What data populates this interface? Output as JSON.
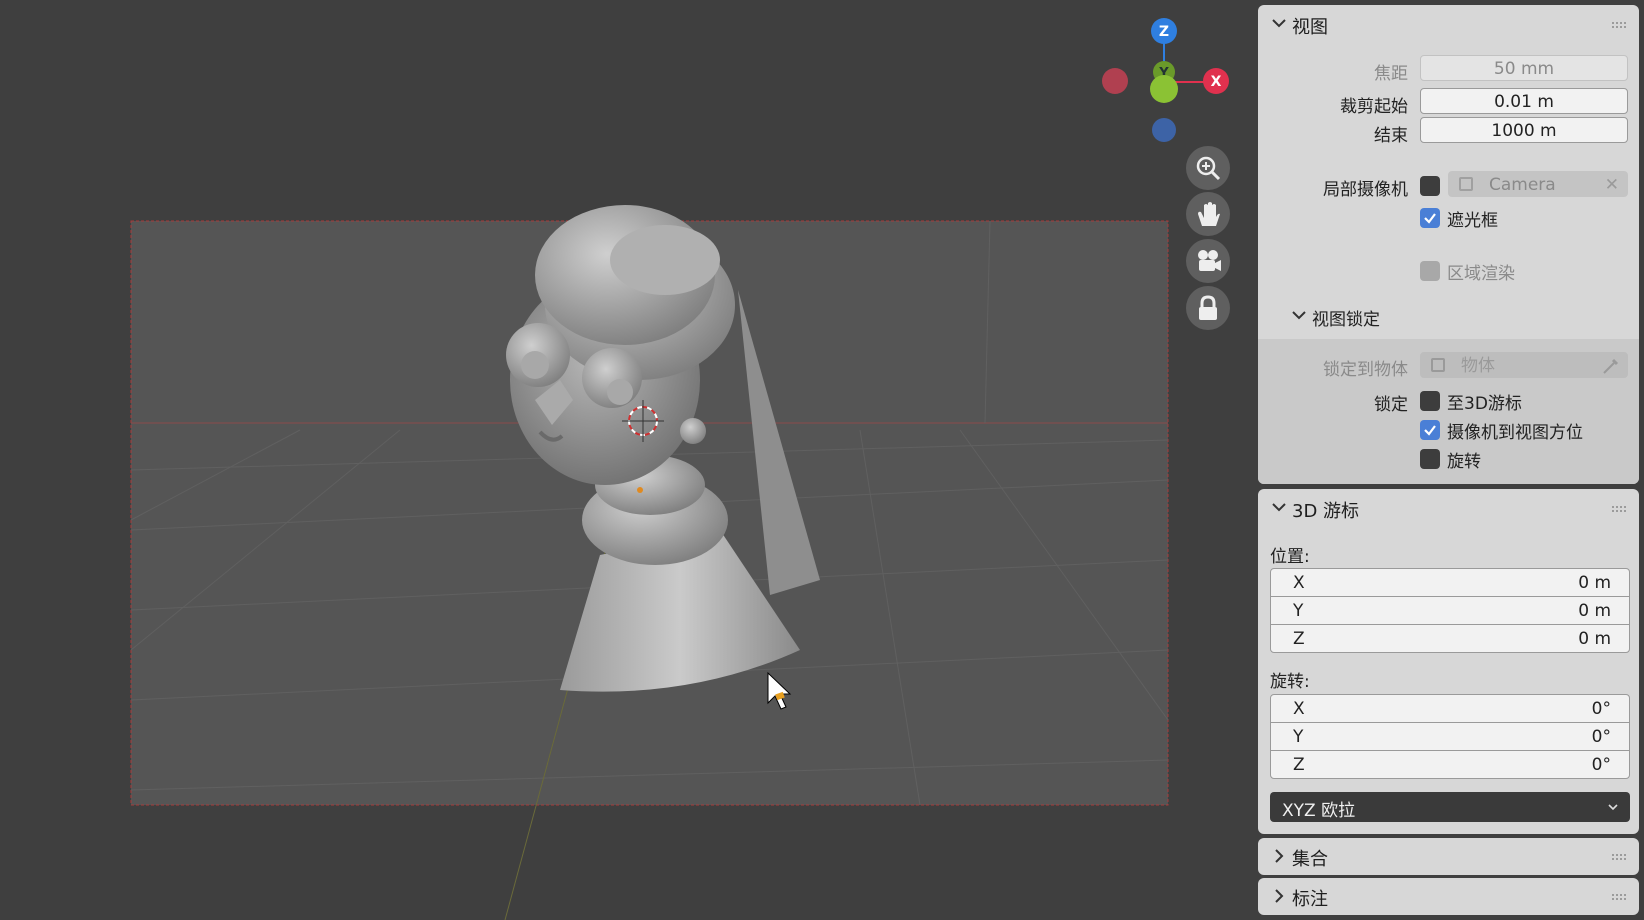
{
  "viewport": {
    "gizmo": {
      "z": "Z",
      "y": "Y",
      "x": "X"
    },
    "nav_buttons": [
      "zoom-icon",
      "hand-pan-icon",
      "camera-view-icon",
      "lock-icon"
    ]
  },
  "sidebar": {
    "view_panel": {
      "title": "视图",
      "focal_label": "焦距",
      "focal_value": "50 mm",
      "clip_start_label": "裁剪起始",
      "clip_start_value": "0.01 m",
      "clip_end_label": "结束",
      "clip_end_value": "1000 m",
      "local_camera_label": "局部摄像机",
      "local_camera_value": "Camera",
      "passepartout_label": "遮光框",
      "region_render_label": "区域渲染",
      "view_lock_title": "视图锁定",
      "lock_to_object_label": "锁定到物体",
      "lock_to_object_placeholder": "物体",
      "lock_label": "锁定",
      "lock_to_cursor_label": "至3D游标",
      "camera_to_view_label": "摄像机到视图方位",
      "lock_rotation_label": "旋转"
    },
    "cursor_panel": {
      "title": "3D 游标",
      "location_label": "位置:",
      "location": [
        {
          "axis": "X",
          "value": "0 m"
        },
        {
          "axis": "Y",
          "value": "0 m"
        },
        {
          "axis": "Z",
          "value": "0 m"
        }
      ],
      "rotation_label": "旋转:",
      "rotation": [
        {
          "axis": "X",
          "value": "0°"
        },
        {
          "axis": "Y",
          "value": "0°"
        },
        {
          "axis": "Z",
          "value": "0°"
        }
      ],
      "rotation_mode": "XYZ 欧拉"
    },
    "collection_panel": {
      "title": "集合"
    },
    "annotation_panel": {
      "title": "标注"
    }
  },
  "colors": {
    "accent": "#4a7fd6",
    "axis_x": "#e0314e",
    "axis_y": "#8bc234",
    "axis_z": "#2f7fe0"
  }
}
